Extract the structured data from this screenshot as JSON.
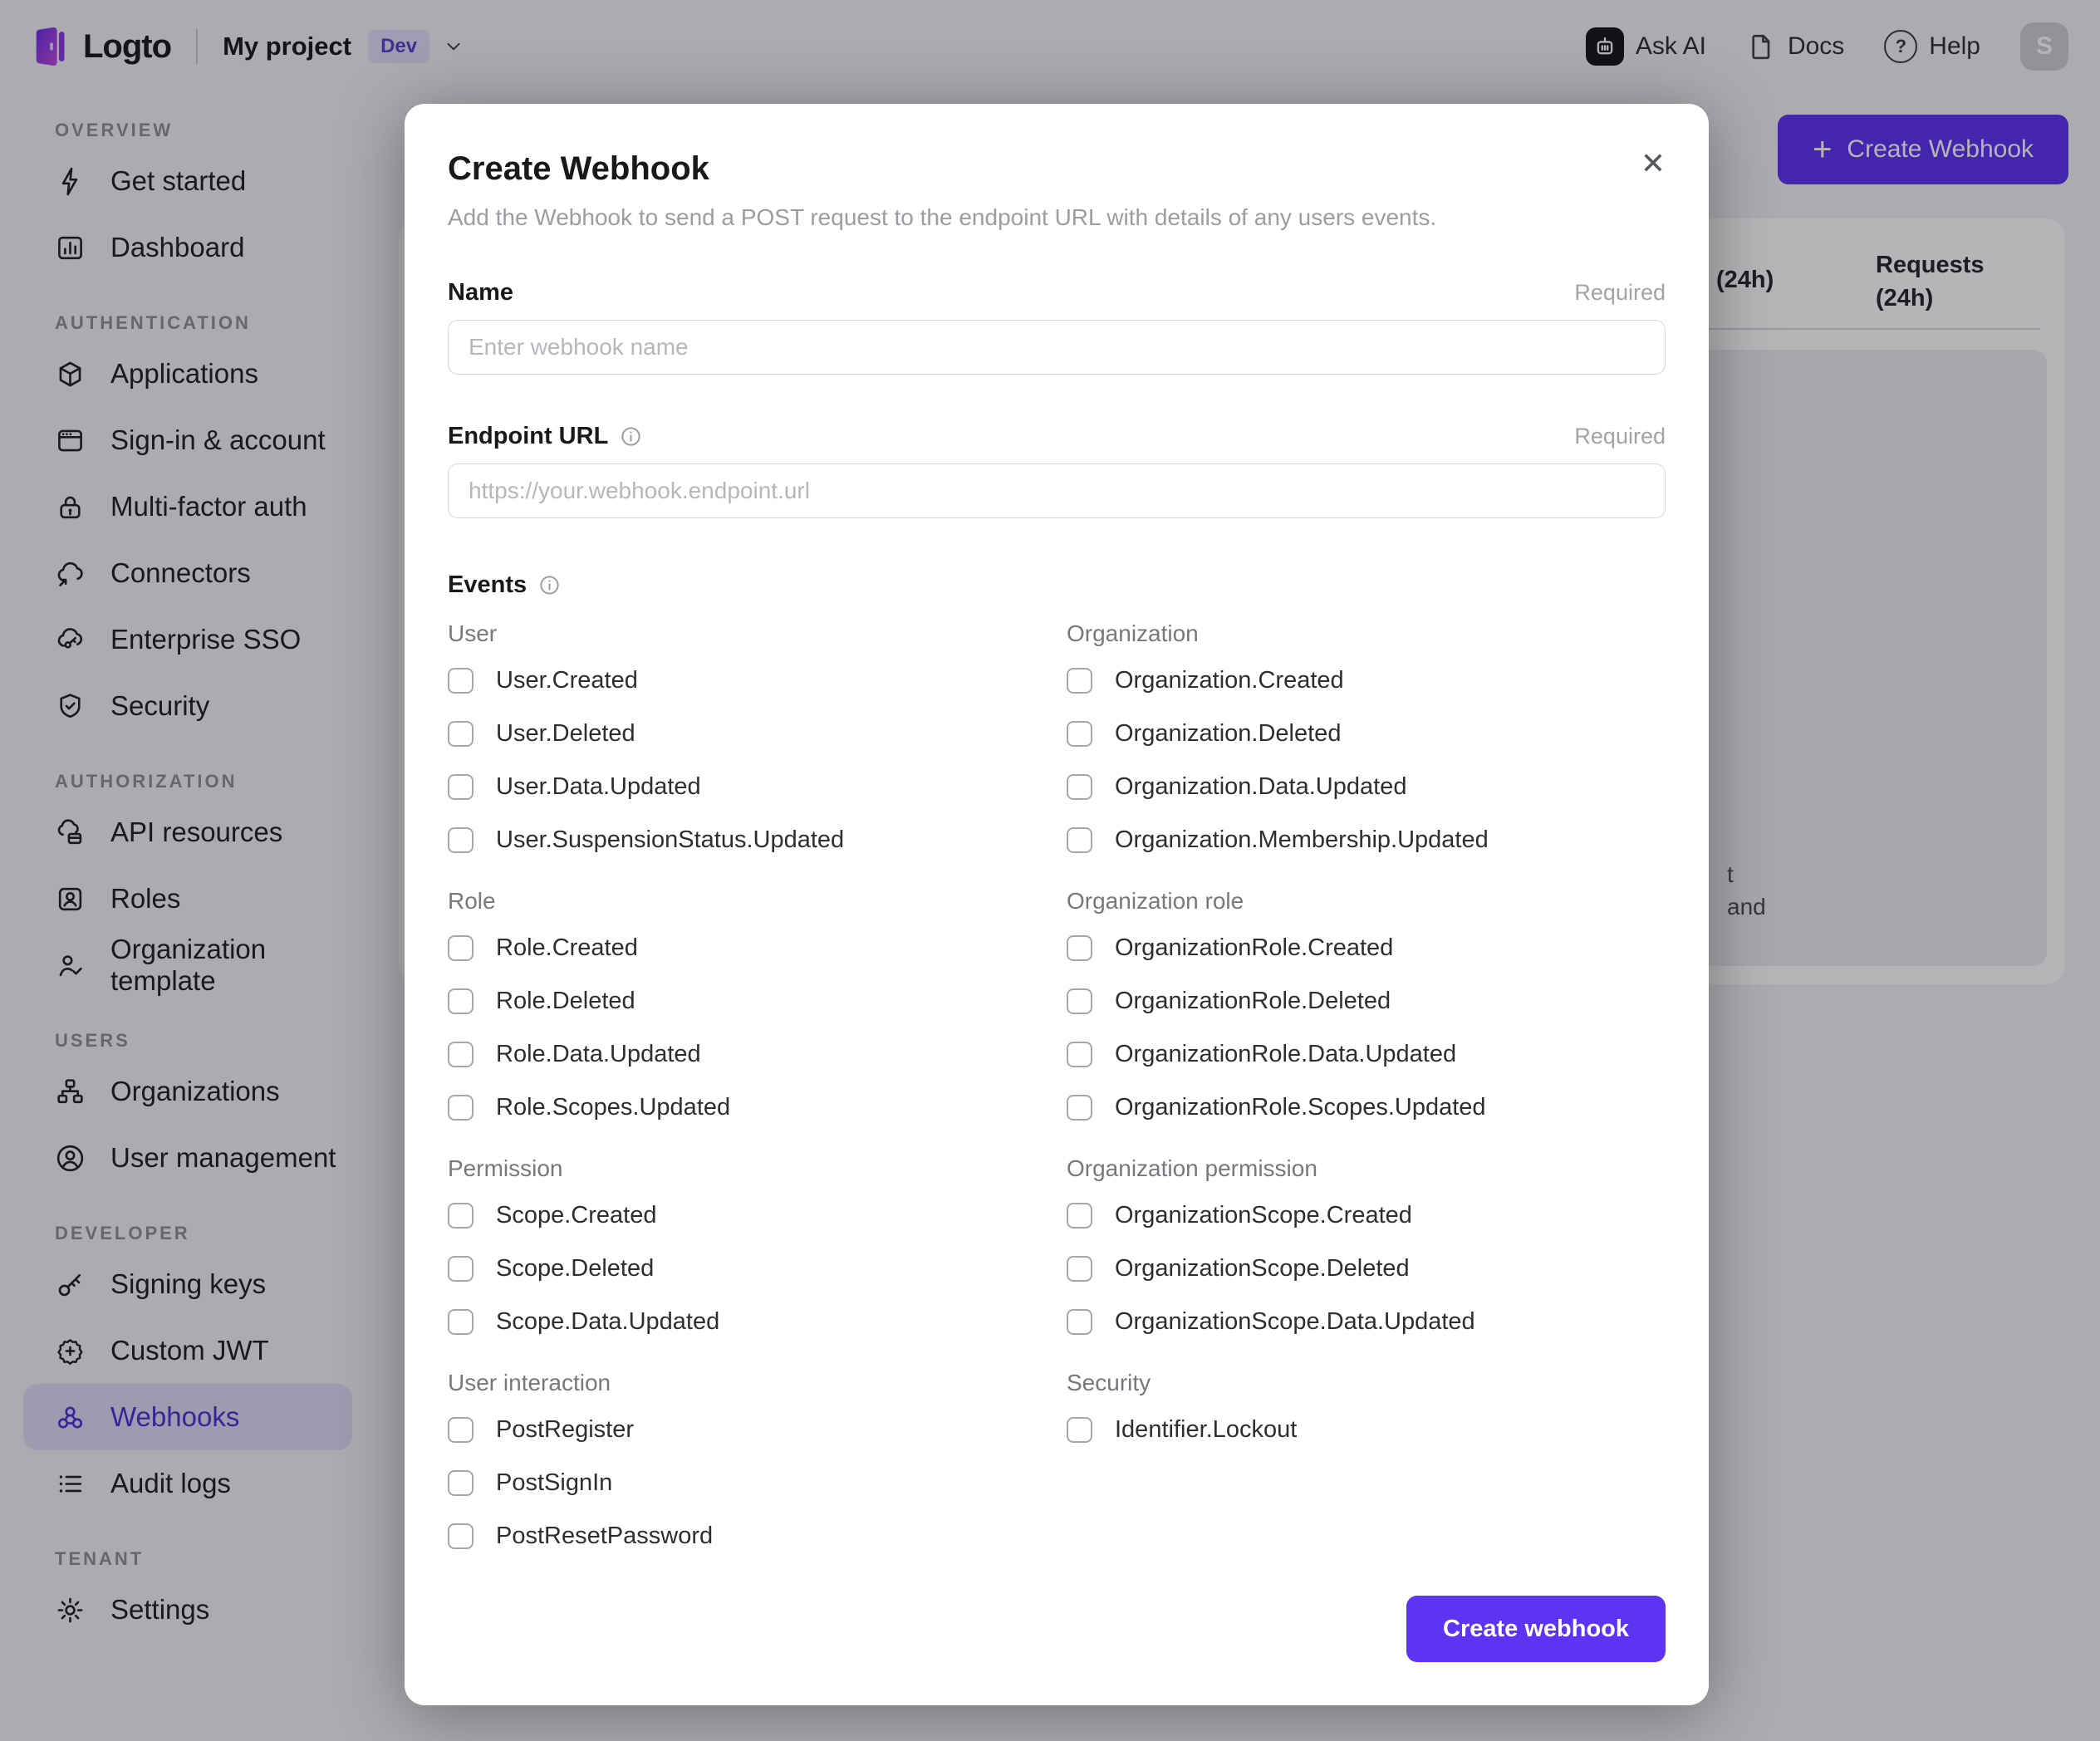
{
  "topbar": {
    "logo_text": "Logto",
    "project_name": "My project",
    "env_badge": "Dev",
    "ask_ai_label": "Ask AI",
    "docs_label": "Docs",
    "help_label": "Help",
    "help_glyph": "?",
    "avatar_initial": "S"
  },
  "sidebar": {
    "sections": [
      {
        "label": "OVERVIEW",
        "items": [
          {
            "label": "Get started",
            "icon": "lightning-icon"
          },
          {
            "label": "Dashboard",
            "icon": "bar-chart-icon"
          }
        ]
      },
      {
        "label": "AUTHENTICATION",
        "items": [
          {
            "label": "Applications",
            "icon": "cube-icon"
          },
          {
            "label": "Sign-in & account",
            "icon": "browser-window-icon"
          },
          {
            "label": "Multi-factor auth",
            "icon": "lock-icon"
          },
          {
            "label": "Connectors",
            "icon": "cloud-connector-icon"
          },
          {
            "label": "Enterprise SSO",
            "icon": "cloud-key-icon"
          },
          {
            "label": "Security",
            "icon": "shield-check-icon"
          }
        ]
      },
      {
        "label": "AUTHORIZATION",
        "items": [
          {
            "label": "API resources",
            "icon": "api-resources-icon"
          },
          {
            "label": "Roles",
            "icon": "role-card-icon"
          },
          {
            "label": "Organization template",
            "icon": "person-check-icon"
          }
        ]
      },
      {
        "label": "USERS",
        "items": [
          {
            "label": "Organizations",
            "icon": "org-chart-icon"
          },
          {
            "label": "User management",
            "icon": "person-circle-icon"
          }
        ]
      },
      {
        "label": "DEVELOPER",
        "items": [
          {
            "label": "Signing keys",
            "icon": "key-icon"
          },
          {
            "label": "Custom JWT",
            "icon": "badge-seal-icon"
          },
          {
            "label": "Webhooks",
            "icon": "webhook-icon",
            "active": true
          },
          {
            "label": "Audit logs",
            "icon": "list-icon"
          }
        ]
      },
      {
        "label": "TENANT",
        "items": [
          {
            "label": "Settings",
            "icon": "gear-icon"
          }
        ]
      }
    ]
  },
  "background": {
    "create_webhook_button": "Create Webhook",
    "plus_glyph": "+",
    "table_header_col1": "(24h)",
    "table_header_col2": "Requests (24h)",
    "empty_state_fragment_line1": "t",
    "empty_state_fragment_line2": "and"
  },
  "modal": {
    "title": "Create Webhook",
    "close_icon": "✕",
    "description": "Add the Webhook to send a POST request to the endpoint URL with details of any users events.",
    "name_field": {
      "label": "Name",
      "required": "Required",
      "placeholder": "Enter webhook name"
    },
    "endpoint_field": {
      "label": "Endpoint URL",
      "required": "Required",
      "placeholder": "https://your.webhook.endpoint.url"
    },
    "events_label": "Events",
    "events": {
      "groups": [
        {
          "title": "User",
          "items": [
            "User.Created",
            "User.Deleted",
            "User.Data.Updated",
            "User.SuspensionStatus.Updated"
          ]
        },
        {
          "title": "Organization",
          "items": [
            "Organization.Created",
            "Organization.Deleted",
            "Organization.Data.Updated",
            "Organization.Membership.Updated"
          ]
        },
        {
          "title": "Role",
          "items": [
            "Role.Created",
            "Role.Deleted",
            "Role.Data.Updated",
            "Role.Scopes.Updated"
          ]
        },
        {
          "title": "Organization role",
          "items": [
            "OrganizationRole.Created",
            "OrganizationRole.Deleted",
            "OrganizationRole.Data.Updated",
            "OrganizationRole.Scopes.Updated"
          ]
        },
        {
          "title": "Permission",
          "items": [
            "Scope.Created",
            "Scope.Deleted",
            "Scope.Data.Updated"
          ]
        },
        {
          "title": "Organization permission",
          "items": [
            "OrganizationScope.Created",
            "OrganizationScope.Deleted",
            "OrganizationScope.Data.Updated"
          ]
        },
        {
          "title": "User interaction",
          "items": [
            "PostRegister",
            "PostSignIn",
            "PostResetPassword"
          ]
        },
        {
          "title": "Security",
          "items": [
            "Identifier.Lockout"
          ]
        }
      ]
    },
    "submit_label": "Create webhook"
  },
  "colors": {
    "accent": "#5d34f2",
    "accent_dim_bg": "rgba(93,52,242,0.13)"
  }
}
